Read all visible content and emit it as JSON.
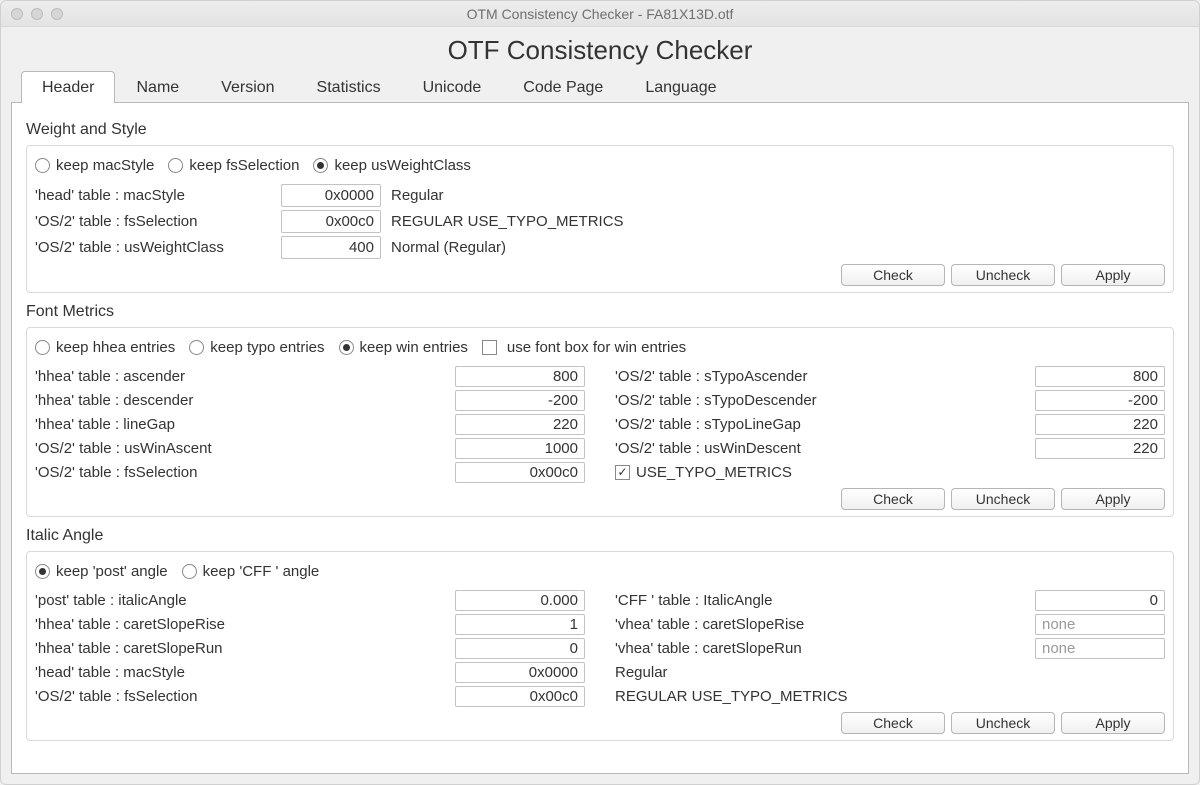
{
  "window_title": "OTM Consistency Checker - FA81X13D.otf",
  "app_title": "OTF Consistency Checker",
  "tabs": [
    "Header",
    "Name",
    "Version",
    "Statistics",
    "Unicode",
    "Code Page",
    "Language"
  ],
  "active_tab_index": 0,
  "buttons": {
    "check": "Check",
    "uncheck": "Uncheck",
    "apply": "Apply"
  },
  "weight_style": {
    "title": "Weight and Style",
    "radios": {
      "keep_macStyle": "keep macStyle",
      "keep_fsSelection": "keep fsSelection",
      "keep_usWeightClass": "keep usWeightClass"
    },
    "radio_selected": "keep_usWeightClass",
    "rows": [
      {
        "label": "'head' table : macStyle",
        "value": "0x0000",
        "desc": "Regular"
      },
      {
        "label": "'OS/2' table : fsSelection",
        "value": "0x00c0",
        "desc": "REGULAR USE_TYPO_METRICS"
      },
      {
        "label": "'OS/2' table : usWeightClass",
        "value": "400",
        "desc": "Normal (Regular)"
      }
    ]
  },
  "font_metrics": {
    "title": "Font Metrics",
    "radios": {
      "keep_hhea": "keep hhea entries",
      "keep_typo": "keep typo entries",
      "keep_win": "keep win entries"
    },
    "radio_selected": "keep_win",
    "checkbox_label": "use font box for win entries",
    "checkbox_checked": false,
    "left": [
      {
        "label": "'hhea' table : ascender",
        "value": "800"
      },
      {
        "label": "'hhea' table : descender",
        "value": "-200"
      },
      {
        "label": "'hhea' table : lineGap",
        "value": "220"
      },
      {
        "label": "'OS/2' table : usWinAscent",
        "value": "1000"
      },
      {
        "label": "'OS/2' table : fsSelection",
        "value": "0x00c0"
      }
    ],
    "right": [
      {
        "label": "'OS/2' table : sTypoAscender",
        "value": "800"
      },
      {
        "label": "'OS/2' table : sTypoDescender",
        "value": "-200"
      },
      {
        "label": "'OS/2' table : sTypoLineGap",
        "value": "220"
      },
      {
        "label": "'OS/2' table : usWinDescent",
        "value": "220"
      }
    ],
    "utm_label": "USE_TYPO_METRICS",
    "utm_checked": true
  },
  "italic": {
    "title": "Italic Angle",
    "radios": {
      "keep_post": "keep 'post' angle",
      "keep_cff": "keep 'CFF ' angle"
    },
    "radio_selected": "keep_post",
    "left": [
      {
        "label": "'post' table : italicAngle",
        "value": "0.000"
      },
      {
        "label": "'hhea' table : caretSlopeRise",
        "value": "1"
      },
      {
        "label": "'hhea' table : caretSlopeRun",
        "value": "0"
      },
      {
        "label": "'head' table : macStyle",
        "value": "0x0000",
        "desc": "Regular"
      },
      {
        "label": "'OS/2' table : fsSelection",
        "value": "0x00c0",
        "desc": "REGULAR USE_TYPO_METRICS"
      }
    ],
    "right": [
      {
        "label": "'CFF ' table : ItalicAngle",
        "value": "0"
      },
      {
        "label": "'vhea' table : caretSlopeRise",
        "value": "none",
        "disabled": true
      },
      {
        "label": "'vhea' table : caretSlopeRun",
        "value": "none",
        "disabled": true
      }
    ]
  }
}
